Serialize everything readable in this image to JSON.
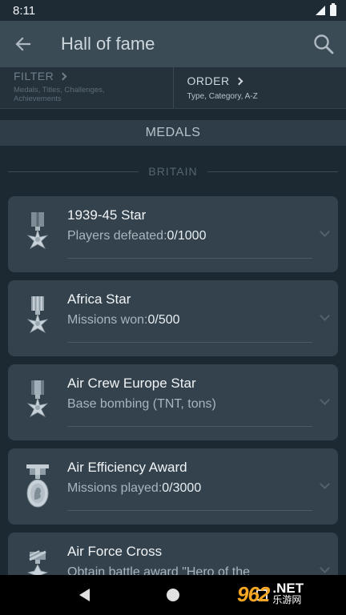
{
  "status_bar": {
    "time": "8:11"
  },
  "app_bar": {
    "title": "Hall of fame"
  },
  "filter": {
    "label": "FILTER",
    "subtitle": "Medals, Titles, Challenges, Achievements"
  },
  "order": {
    "label": "ORDER",
    "subtitle": "Type, Category, A-Z"
  },
  "section": {
    "title": "MEDALS",
    "subsection": "BRITAIN"
  },
  "medals": [
    {
      "name": "1939-45 Star",
      "label": "Players defeated:",
      "value": "0/1000",
      "icon": "star-medal-icon"
    },
    {
      "name": "Africa Star",
      "label": "Missions won:",
      "value": "0/500",
      "icon": "star-medal-icon"
    },
    {
      "name": "Air Crew Europe Star",
      "label": "Base bombing (TNT, tons)",
      "value": "",
      "icon": "star-medal-icon"
    },
    {
      "name": "Air Efficiency Award",
      "label": "Missions played:",
      "value": "0/3000",
      "icon": "oval-medal-icon"
    },
    {
      "name": "Air Force Cross",
      "label": "Obtain battle award \"Hero of the",
      "value": "",
      "icon": "cross-medal-icon"
    }
  ],
  "watermark": {
    "number": "962",
    "domain": ".NET",
    "chinese": "乐游网"
  },
  "colors": {
    "background": "#1c2832",
    "app_bar": "#3b4b56",
    "card": "#33424d",
    "watermark_accent": "#f5a623"
  }
}
